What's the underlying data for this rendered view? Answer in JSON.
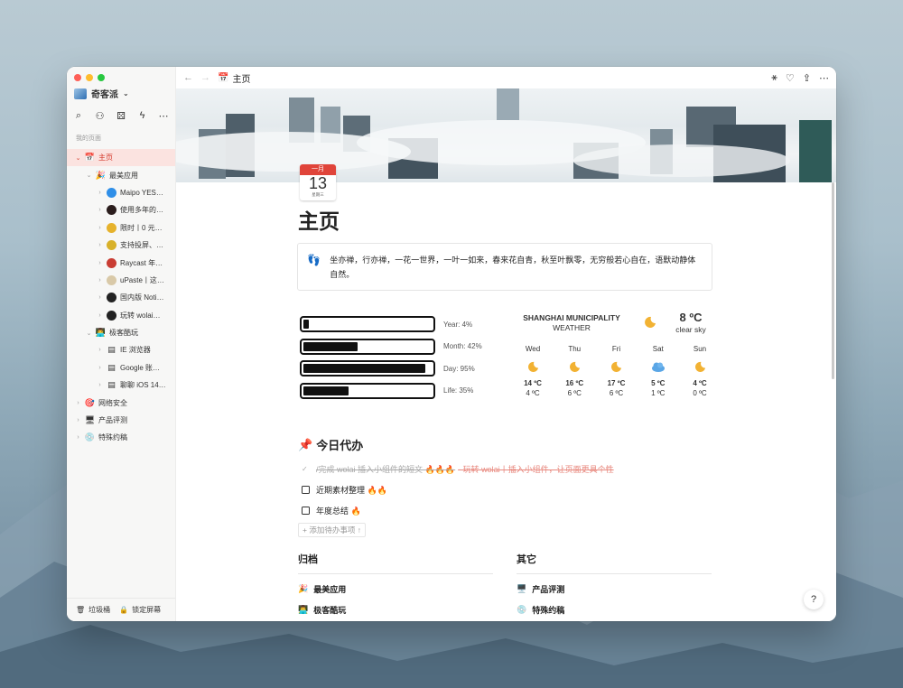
{
  "workspace": {
    "name": "奇客派"
  },
  "sidebar": {
    "section_label": "我的页面",
    "items": [
      {
        "label": "主页",
        "icon": "calendar-icon",
        "level": 0,
        "expanded": true,
        "active": true
      },
      {
        "label": "最美应用",
        "icon": "party-popper-icon",
        "level": 1,
        "expanded": true
      },
      {
        "label": "Maipo YES…",
        "icon": "maipo-app-icon",
        "level": 2
      },
      {
        "label": "使用多年的…",
        "icon": "red-dot-app-icon",
        "level": 2
      },
      {
        "label": "限时丨0 元…",
        "icon": "yellow-app-icon",
        "level": 2
      },
      {
        "label": "支持投屏、…",
        "icon": "infuse-app-icon",
        "level": 2
      },
      {
        "label": "Raycast 年…",
        "icon": "raycast-app-icon",
        "level": 2
      },
      {
        "label": "uPaste丨这…",
        "icon": "upaste-app-icon",
        "level": 2
      },
      {
        "label": "国内版 Noti…",
        "icon": "notion-app-icon",
        "level": 2
      },
      {
        "label": "玩转 wolai…",
        "icon": "wolai-app-icon",
        "level": 2
      },
      {
        "label": "极客酷玩",
        "icon": "person-laptop-icon",
        "level": 1,
        "expanded": true
      },
      {
        "label": "IE 浏览器",
        "icon": "page-icon",
        "level": 2
      },
      {
        "label": "Google 账…",
        "icon": "page-icon",
        "level": 2
      },
      {
        "label": "聊聊 iOS 14…",
        "icon": "page-icon",
        "level": 2
      },
      {
        "label": "网络安全",
        "icon": "target-icon",
        "level": 0
      },
      {
        "label": "产品评测",
        "icon": "monitor-icon",
        "level": 0
      },
      {
        "label": "特殊约稿",
        "icon": "disc-icon",
        "level": 0
      }
    ],
    "footer": {
      "trash": "垃圾桶",
      "lock": "锁定屏幕"
    }
  },
  "topbar": {
    "title": "主页"
  },
  "page": {
    "title": "主页",
    "icon_month": "一月",
    "icon_day": "13",
    "icon_weekday": "星期三",
    "quote": "坐亦禅，行亦禅，一花一世界，一叶一如来，春来花自青，秋至叶飘零，无穷般若心自在，语默动静体自然。"
  },
  "progress": [
    {
      "label": "Year: 4%",
      "value": 4
    },
    {
      "label": "Month: 42%",
      "value": 42
    },
    {
      "label": "Day: 95%",
      "value": 95
    },
    {
      "label": "Life: 35%",
      "value": 35
    }
  ],
  "weather": {
    "location": "SHANGHAI MUNICIPALITY",
    "subtitle": "WEATHER",
    "current_temp": "8 ºC",
    "current_desc": "clear sky",
    "days": [
      {
        "day": "Wed",
        "icon": "moon-icon",
        "high": "14 ºC",
        "low": "4 ºC"
      },
      {
        "day": "Thu",
        "icon": "moon-icon",
        "high": "16 ºC",
        "low": "6 ºC"
      },
      {
        "day": "Fri",
        "icon": "moon-icon",
        "high": "17 ºC",
        "low": "6 ºC"
      },
      {
        "day": "Sat",
        "icon": "cloud-icon",
        "high": "5 ºC",
        "low": "1 ºC"
      },
      {
        "day": "Sun",
        "icon": "moon-icon",
        "high": "4 ºC",
        "low": "0 ºC"
      }
    ]
  },
  "todo": {
    "heading": "今日代办",
    "items": [
      {
        "text": "/完成 wolai 插入小组件的短文 🔥🔥🔥",
        "extra": "- 玩转 wolai丨插入小组件，让页面更具个性",
        "done": true
      },
      {
        "text": "近期素材整理 🔥🔥",
        "done": false
      },
      {
        "text": "年度总结 🔥",
        "done": false
      }
    ],
    "add_label": "+ 添加待办事项 ↑"
  },
  "archive": {
    "heading": "归档",
    "links": [
      {
        "label": "最美应用",
        "icon": "🎉"
      },
      {
        "label": "极客酷玩",
        "icon": "👨‍💻"
      }
    ]
  },
  "other": {
    "heading": "其它",
    "links": [
      {
        "label": "产品评测",
        "icon": "🖥️"
      },
      {
        "label": "特殊约稿",
        "icon": "💿"
      }
    ]
  },
  "help_label": "?",
  "colors": {
    "accent": "#d43a2c",
    "traffic_red": "#fe5f57",
    "traffic_yellow": "#febc2e",
    "traffic_green": "#28c840"
  }
}
